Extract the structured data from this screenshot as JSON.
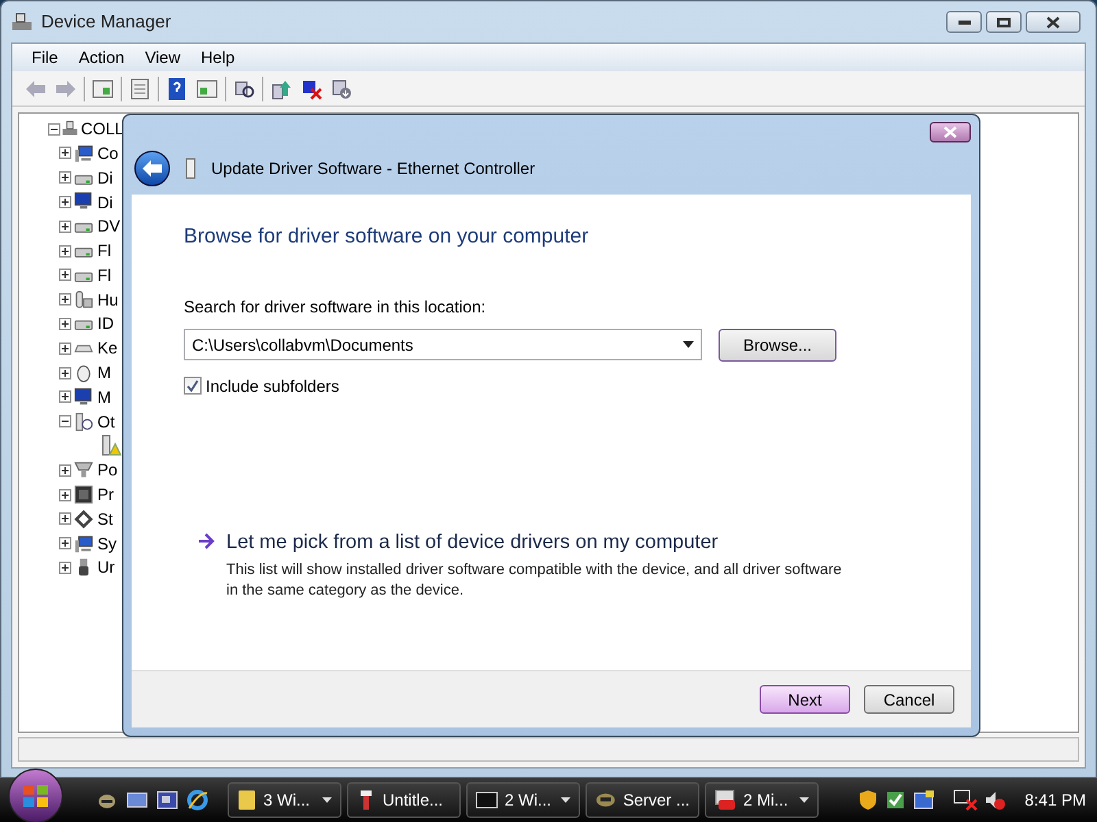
{
  "window": {
    "title": "Device Manager"
  },
  "menu": [
    "File",
    "Action",
    "View",
    "Help"
  ],
  "tree": {
    "label": "COLL",
    "expanded": true,
    "children": [
      {
        "label": "Co",
        "expanded": false
      },
      {
        "label": "Di",
        "expanded": false
      },
      {
        "label": "Di",
        "expanded": false
      },
      {
        "label": "DV",
        "expanded": false
      },
      {
        "label": "Fl",
        "expanded": false
      },
      {
        "label": "Fl",
        "expanded": false
      },
      {
        "label": "Hu",
        "expanded": false
      },
      {
        "label": "ID",
        "expanded": false
      },
      {
        "label": "Ke",
        "expanded": false
      },
      {
        "label": "M",
        "expanded": false
      },
      {
        "label": "M",
        "expanded": false
      },
      {
        "label": "Ot",
        "expanded": true,
        "children": [
          {
            "warning": true
          }
        ]
      },
      {
        "label": "Po",
        "expanded": false
      },
      {
        "label": "Pr",
        "expanded": false
      },
      {
        "label": "St",
        "expanded": false
      },
      {
        "label": "Sy",
        "expanded": false
      },
      {
        "label": "Ur",
        "expanded": false
      }
    ]
  },
  "dialog": {
    "title": "Update Driver Software - Ethernet Controller",
    "heading": "Browse for driver software on your computer",
    "location_label": "Search for driver software in this location:",
    "location_value": "C:\\Users\\collabvm\\Documents",
    "browse_button": "Browse...",
    "include_subfolders": {
      "label": "Include subfolders",
      "checked": true
    },
    "pick_link": {
      "title": "Let me pick from a list of device drivers on my computer",
      "description": "This list will show installed driver software compatible with the device, and all driver software in the same category as the device."
    },
    "buttons": [
      {
        "label": "Next",
        "selected": true
      },
      {
        "label": "Cancel",
        "selected": false
      }
    ]
  },
  "taskbar": {
    "buttons": [
      {
        "label": "3 Wi...",
        "grouped": true
      },
      {
        "label": "Untitle...",
        "grouped": false
      },
      {
        "label": "2 Wi...",
        "grouped": true
      },
      {
        "label": "Server ...",
        "grouped": false
      },
      {
        "label": "2 Mi...",
        "grouped": true
      }
    ],
    "clock": "8:41 PM"
  }
}
